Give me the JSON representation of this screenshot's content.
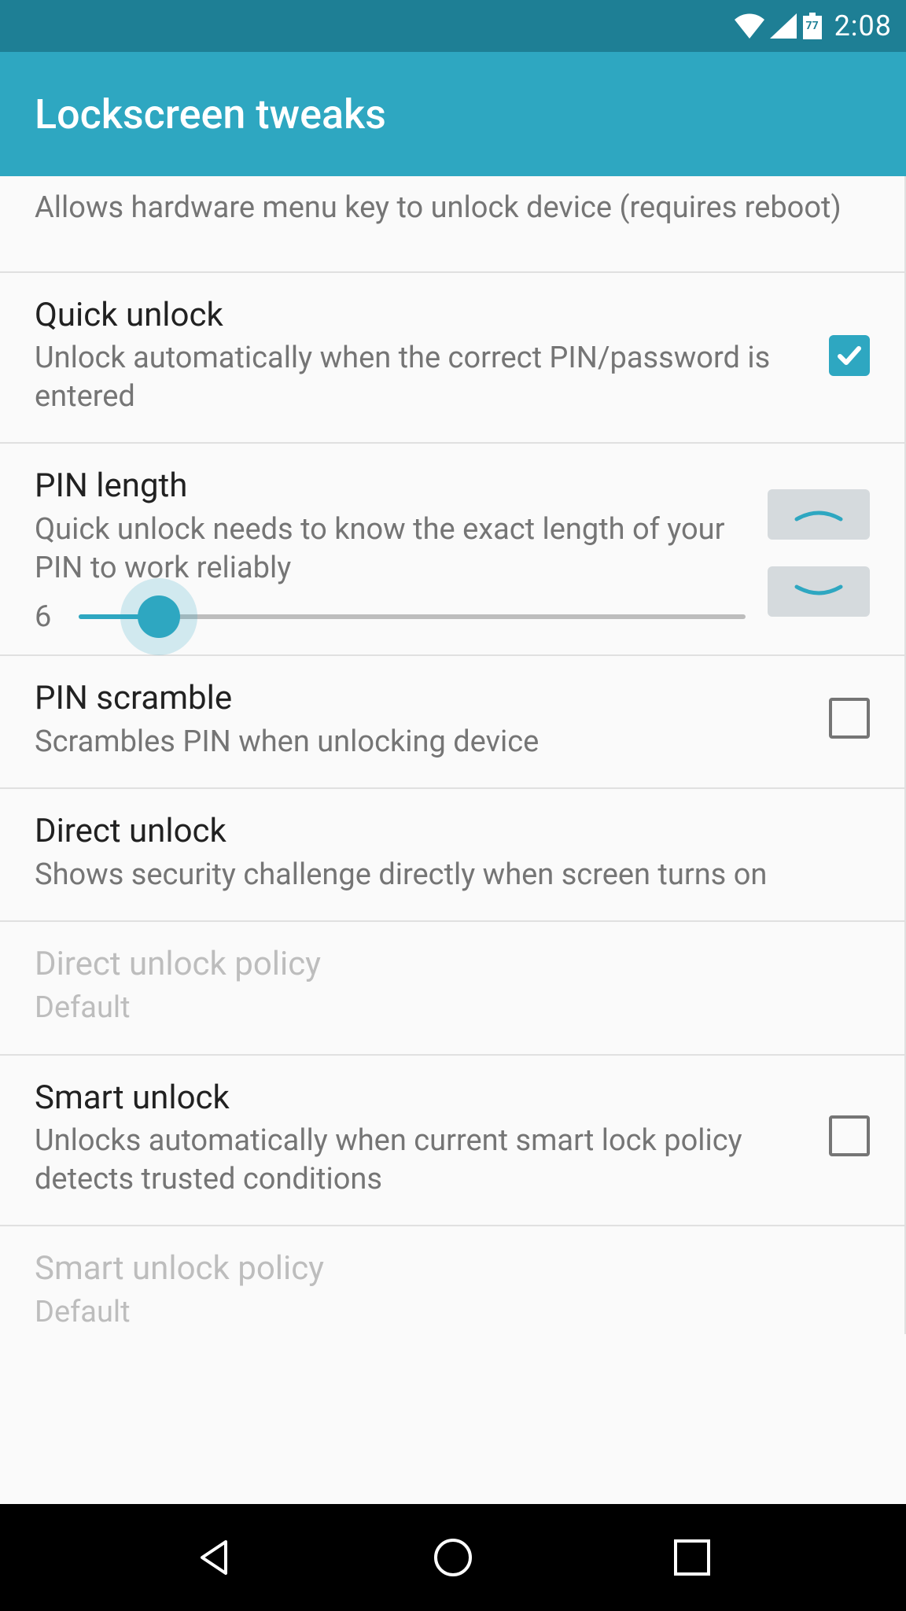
{
  "status": {
    "battery": "77",
    "time": "2:08"
  },
  "appbar": {
    "title": "Lockscreen tweaks"
  },
  "items": {
    "hw_menu": {
      "summary": "Allows hardware menu key to unlock device (requires reboot)"
    },
    "quick_unlock": {
      "title": "Quick unlock",
      "summary": "Unlock automatically when the correct PIN/password is entered",
      "checked": true
    },
    "pin_length": {
      "title": "PIN length",
      "summary": "Quick unlock needs to know the exact length of your PIN to work reliably",
      "value": "6",
      "slider_percent": 12
    },
    "pin_scramble": {
      "title": "PIN scramble",
      "summary": "Scrambles PIN when unlocking device",
      "checked": false
    },
    "direct_unlock": {
      "title": "Direct unlock",
      "summary": "Shows security challenge directly when screen turns on"
    },
    "direct_unlock_policy": {
      "title": "Direct unlock policy",
      "summary": "Default",
      "disabled": true
    },
    "smart_unlock": {
      "title": "Smart unlock",
      "summary": "Unlocks automatically when current smart lock policy detects trusted conditions",
      "checked": false
    },
    "smart_unlock_policy": {
      "title": "Smart unlock policy",
      "summary": "Default",
      "disabled": true
    }
  },
  "colors": {
    "status_bar": "#1e7f95",
    "app_bar": "#2ea7c1",
    "accent": "#2ea7c1",
    "text_primary": "#212121",
    "text_secondary": "#757575",
    "text_disabled": "#bdbdbd",
    "divider": "#e0e0e0",
    "nav_bar": "#000000",
    "stepper_bg": "#d5dadd"
  }
}
